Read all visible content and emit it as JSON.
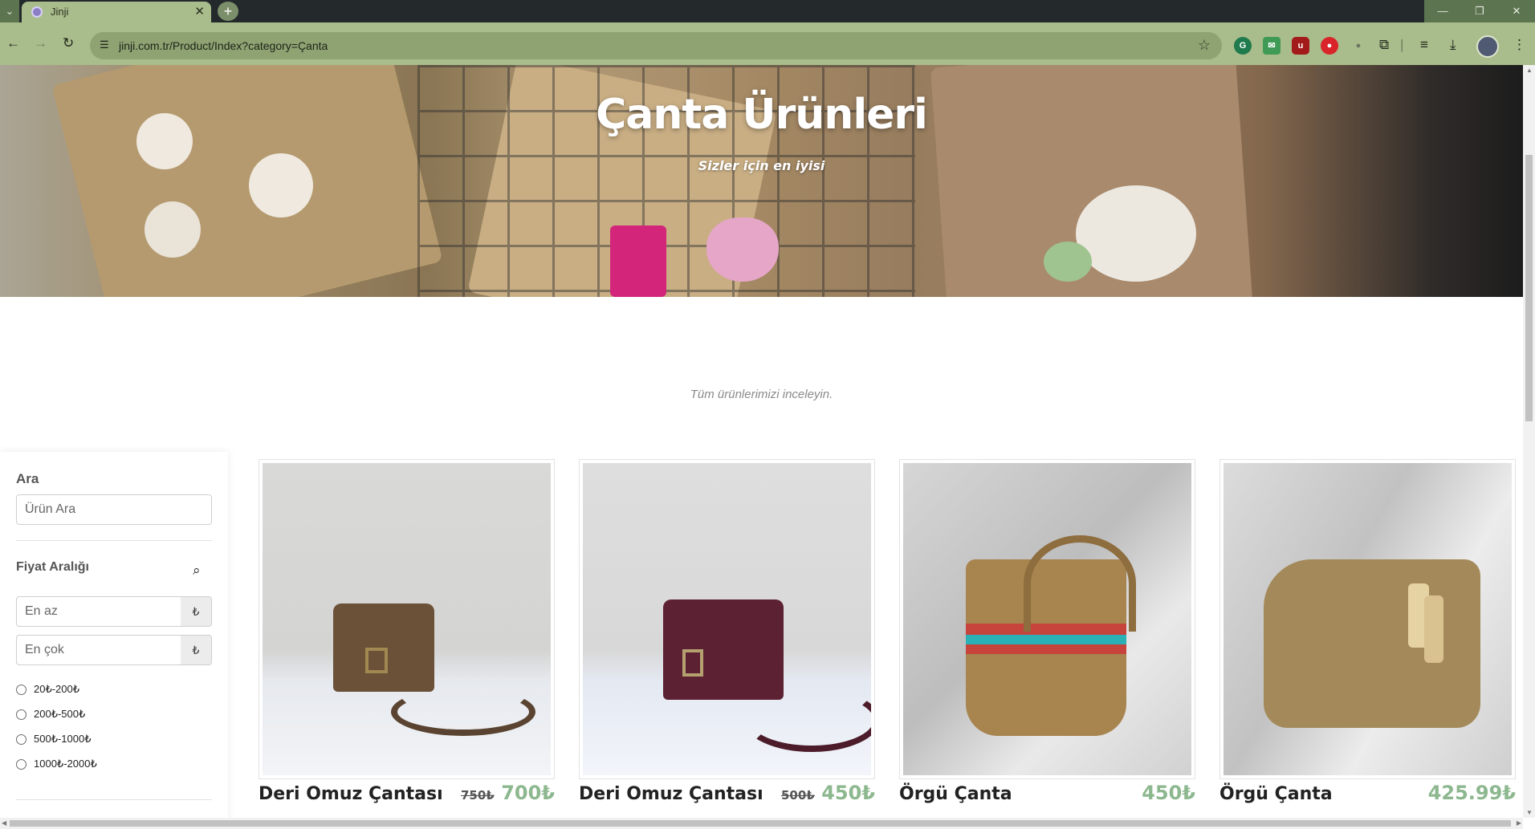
{
  "browser": {
    "tab_title": "Jinji",
    "url": "jinji.com.tr/Product/Index?category=Çanta",
    "colors": {
      "frame": "#a9bc8b",
      "omnibox": "#8ea272",
      "tabstrip": "#24292c"
    }
  },
  "hero": {
    "title": "Çanta Ürünleri",
    "subtitle": "Sizler için en iyisi"
  },
  "intro_text": "Tüm ürünlerimizi inceleyin.",
  "sidebar": {
    "search_heading": "Ara",
    "search_placeholder": "Ürün Ara",
    "price_heading": "Fiyat Aralığı",
    "min_placeholder": "En az",
    "max_placeholder": "En çok",
    "currency_symbol": "₺",
    "price_ranges": [
      "20₺-200₺",
      "200₺-500₺",
      "500₺-1000₺",
      "1000₺-2000₺"
    ]
  },
  "products": [
    {
      "name": "Deri Omuz Çantası",
      "old_price": "750₺",
      "price": "700₺"
    },
    {
      "name": "Deri Omuz Çantası",
      "old_price": "500₺",
      "price": "450₺"
    },
    {
      "name": "Örgü Çanta",
      "old_price": "",
      "price": "450₺"
    },
    {
      "name": "Örgü Çanta",
      "old_price": "",
      "price": "425.99₺"
    }
  ],
  "colors": {
    "price_accent": "#8db88f",
    "heading_text": "#222222"
  }
}
